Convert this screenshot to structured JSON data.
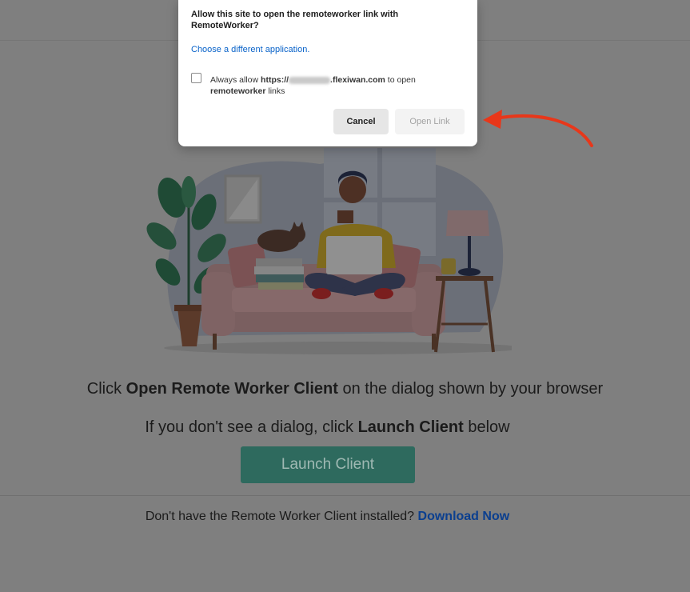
{
  "dialog": {
    "title": "Allow this site to open the remoteworker link with RemoteWorker?",
    "choose_link": "Choose a different application.",
    "allow_prefix": "Always allow ",
    "allow_url_start": "https://",
    "allow_url_end": ".flexiwan.com",
    "allow_middle": " to open ",
    "allow_scheme": "remoteworker",
    "allow_suffix": " links",
    "checkbox_checked": false,
    "cancel_label": "Cancel",
    "open_label": "Open Link"
  },
  "page": {
    "line1_pre": "Click ",
    "line1_bold": "Open Remote Worker Client",
    "line1_post": " on the dialog shown by your browser",
    "line2_pre": "If you don't see a dialog, click ",
    "line2_bold": "Launch Client",
    "line2_post": " below",
    "launch_label": "Launch Client",
    "download_text": "Don't have the Remote Worker Client installed? ",
    "download_link": "Download Now"
  },
  "colors": {
    "overlay_bg": "#7f7f7f",
    "launch_button": "#2e6a5e",
    "link_blue": "#0a63c9",
    "arrow_red": "#e8371a"
  }
}
